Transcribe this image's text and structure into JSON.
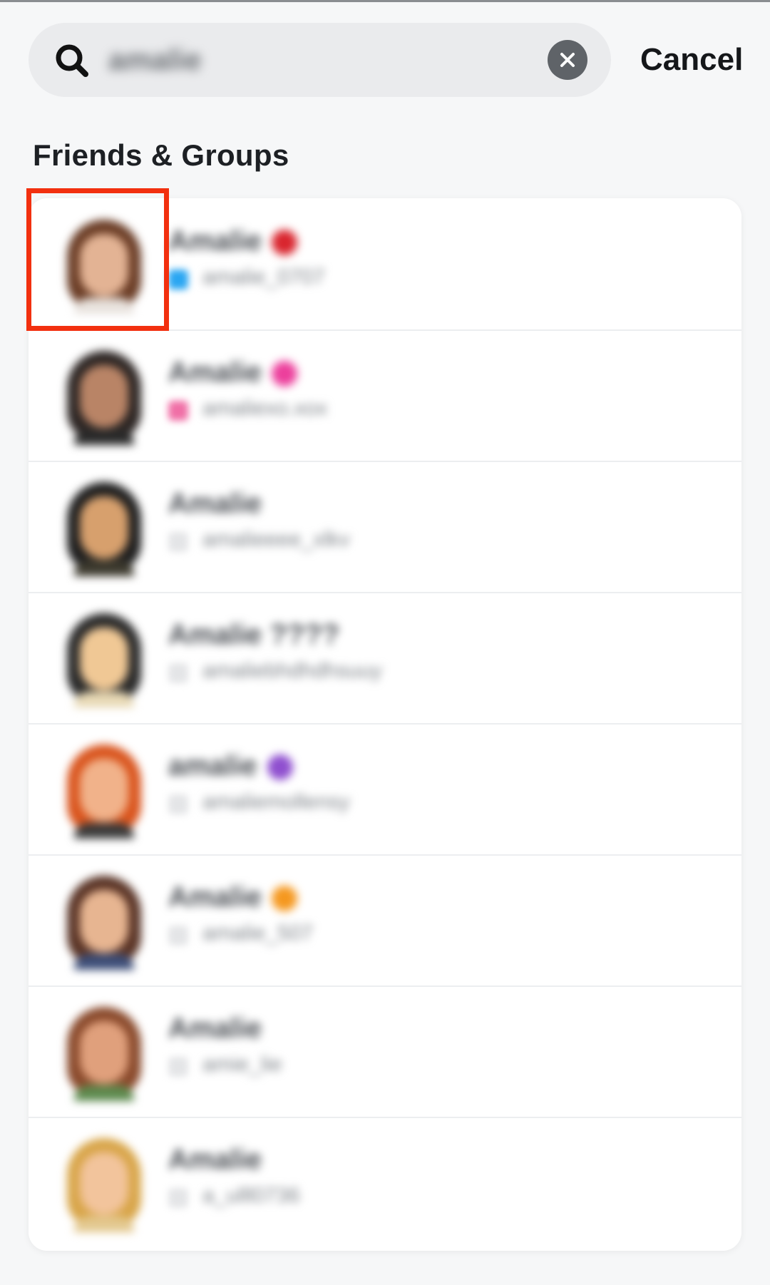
{
  "search": {
    "query": "amalie",
    "cancel_label": "Cancel"
  },
  "section": {
    "title": "Friends & Groups"
  },
  "results": [
    {
      "name": "Amalie",
      "username": "amalie_0707",
      "emoji_color": "#d9252e",
      "icon_color": "#2aa6f2",
      "hair": "#6b3d26",
      "face": "#e3b394",
      "body": "#e8e2dd"
    },
    {
      "name": "Amalie",
      "username": "amaliexo.xox",
      "emoji_color": "#ec3f9c",
      "icon_color": "#f06fa6",
      "hair": "#2d2624",
      "face": "#b98466",
      "body": "#2a2a2a"
    },
    {
      "name": "Amalie",
      "username": "amalieeee_xlkv",
      "emoji_color": "",
      "icon_color": "#e4e5e7",
      "hair": "#1f1f1f",
      "face": "#d7a06d",
      "body": "#3d3a2e"
    },
    {
      "name": "Amalie ????",
      "username": "amaliebhdhdhsuuy",
      "emoji_color": "",
      "icon_color": "#e4e5e7",
      "hair": "#2a2a2a",
      "face": "#f0c895",
      "body": "#e8d9b5"
    },
    {
      "name": "amalie",
      "username": "amaliemollensy",
      "emoji_color": "#8f4fcf",
      "icon_color": "#e4e5e7",
      "hair": "#d9541d",
      "face": "#f1b28a",
      "body": "#3b3b3b"
    },
    {
      "name": "Amalie",
      "username": "amalie_507",
      "emoji_color": "#f5981f",
      "icon_color": "#e4e5e7",
      "hair": "#5a3426",
      "face": "#e7b591",
      "body": "#3d4e78"
    },
    {
      "name": "Amalie",
      "username": "amie_lie",
      "emoji_color": "",
      "icon_color": "#e4e5e7",
      "hair": "#8a4a2c",
      "face": "#e0a07c",
      "body": "#5d8a4e"
    },
    {
      "name": "Amalie",
      "username": "a_ulll0736",
      "emoji_color": "",
      "icon_color": "#e4e5e7",
      "hair": "#d8a549",
      "face": "#f2c49c",
      "body": "#e3c88f"
    }
  ],
  "colors": {
    "highlight": "#f2300f",
    "background": "#f6f7f8"
  }
}
